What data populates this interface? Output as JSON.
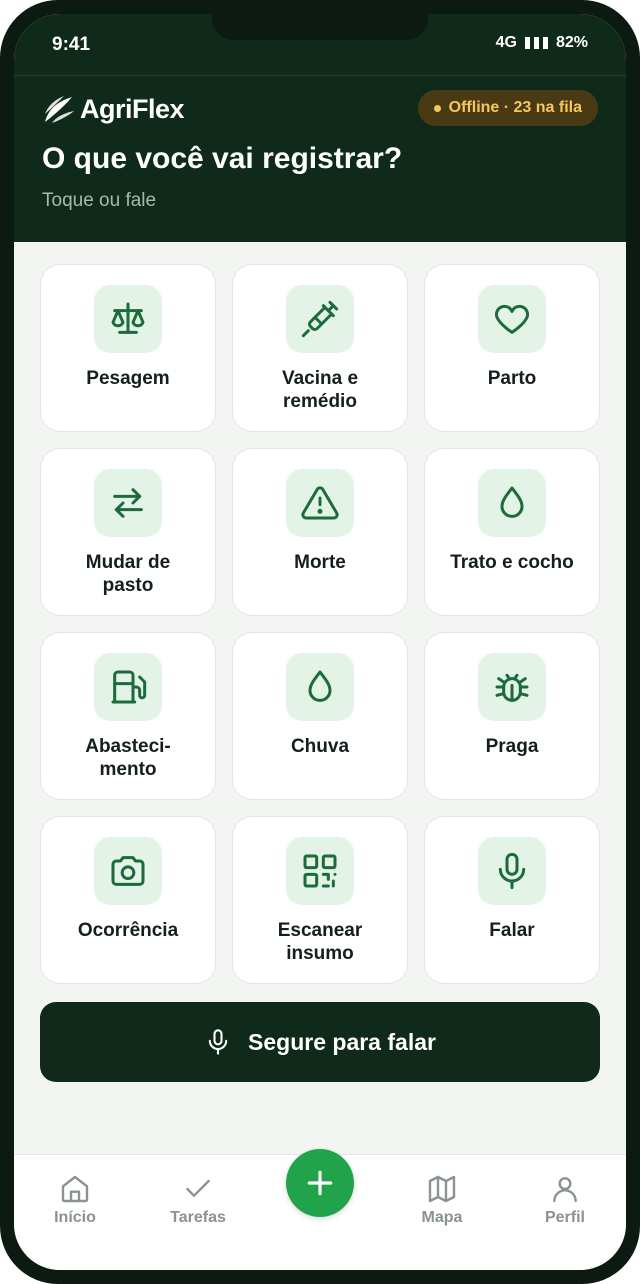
{
  "status_bar": {
    "time": "9:41",
    "network": "4G",
    "battery": "82%"
  },
  "header": {
    "brand": "AgriFlex",
    "offline_badge": "Offline · 23 na fila",
    "title": "O que você vai registrar?",
    "subtitle": "Toque ou fale"
  },
  "actions": [
    {
      "label": "Pesagem",
      "icon": "scale-icon"
    },
    {
      "label": "Vacina e\nremédio",
      "icon": "syringe-icon"
    },
    {
      "label": "Parto",
      "icon": "heart-icon"
    },
    {
      "label": "Mudar de\npasto",
      "icon": "swap-arrows-icon"
    },
    {
      "label": "Morte",
      "icon": "warning-icon"
    },
    {
      "label": "Trato e cocho",
      "icon": "drop-icon"
    },
    {
      "label": "Abasteci-\nmento",
      "icon": "fuel-pump-icon"
    },
    {
      "label": "Chuva",
      "icon": "drop-icon"
    },
    {
      "label": "Praga",
      "icon": "bug-icon"
    },
    {
      "label": "Ocorrência",
      "icon": "camera-icon"
    },
    {
      "label": "Escanear\ninsumo",
      "icon": "qr-code-icon"
    },
    {
      "label": "Falar",
      "icon": "microphone-icon"
    }
  ],
  "voice_button": {
    "label": "Segure para falar",
    "icon": "microphone-icon"
  },
  "bottom_nav": [
    {
      "label": "Início",
      "icon": "home-icon"
    },
    {
      "label": "Tarefas",
      "icon": "check-icon"
    },
    {
      "label": "Mapa",
      "icon": "map-icon"
    },
    {
      "label": "Perfil",
      "icon": "user-icon"
    }
  ],
  "fab": {
    "icon": "plus-icon"
  },
  "colors": {
    "header_bg": "#0f2a1a",
    "accent_green": "#21a34b",
    "icon_green": "#1c6b3a",
    "tile_icon_bg": "#e3f3e7",
    "offline_text": "#f3c860"
  }
}
